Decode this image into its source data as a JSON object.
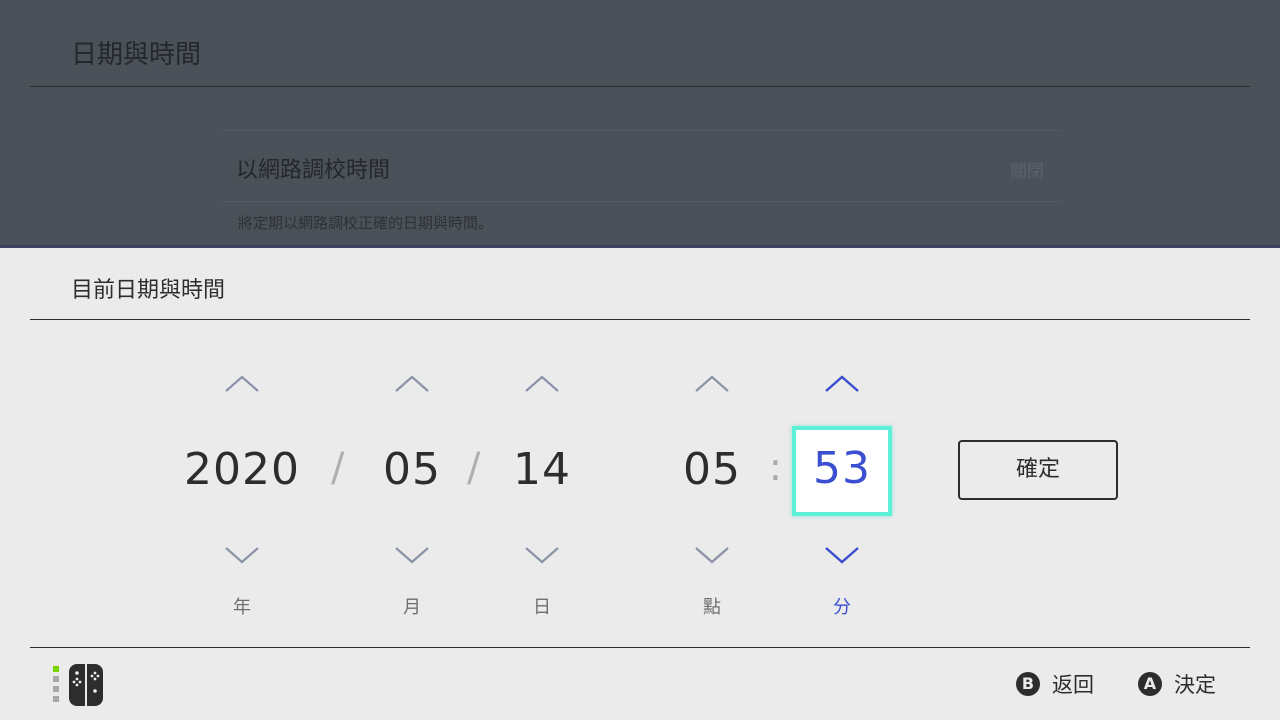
{
  "background": {
    "title": "日期與時間",
    "row_label": "以網路調校時間",
    "row_value": "關閉",
    "description": "將定期以網路調校正確的日期與時間。"
  },
  "panel": {
    "title": "目前日期與時間",
    "separators": {
      "date": "/",
      "time": ":"
    },
    "fields": {
      "year": {
        "value": "2020",
        "unit": "年"
      },
      "month": {
        "value": "05",
        "unit": "月"
      },
      "day": {
        "value": "14",
        "unit": "日"
      },
      "hour": {
        "value": "05",
        "unit": "點"
      },
      "minute": {
        "value": "53",
        "unit": "分"
      }
    },
    "confirm_label": "確定"
  },
  "footer": {
    "back": {
      "glyph": "B",
      "label": "返回"
    },
    "ok": {
      "glyph": "A",
      "label": "決定"
    }
  },
  "colors": {
    "accent_blue": "#3b4fd0",
    "selection_border": "#5ef0d8",
    "arrow_gray": "#8a93a6",
    "player_indicator": "#7ad400"
  },
  "icons": {
    "up": "chevron-up-icon",
    "down": "chevron-down-icon",
    "controller": "joycon-controller-icon"
  }
}
